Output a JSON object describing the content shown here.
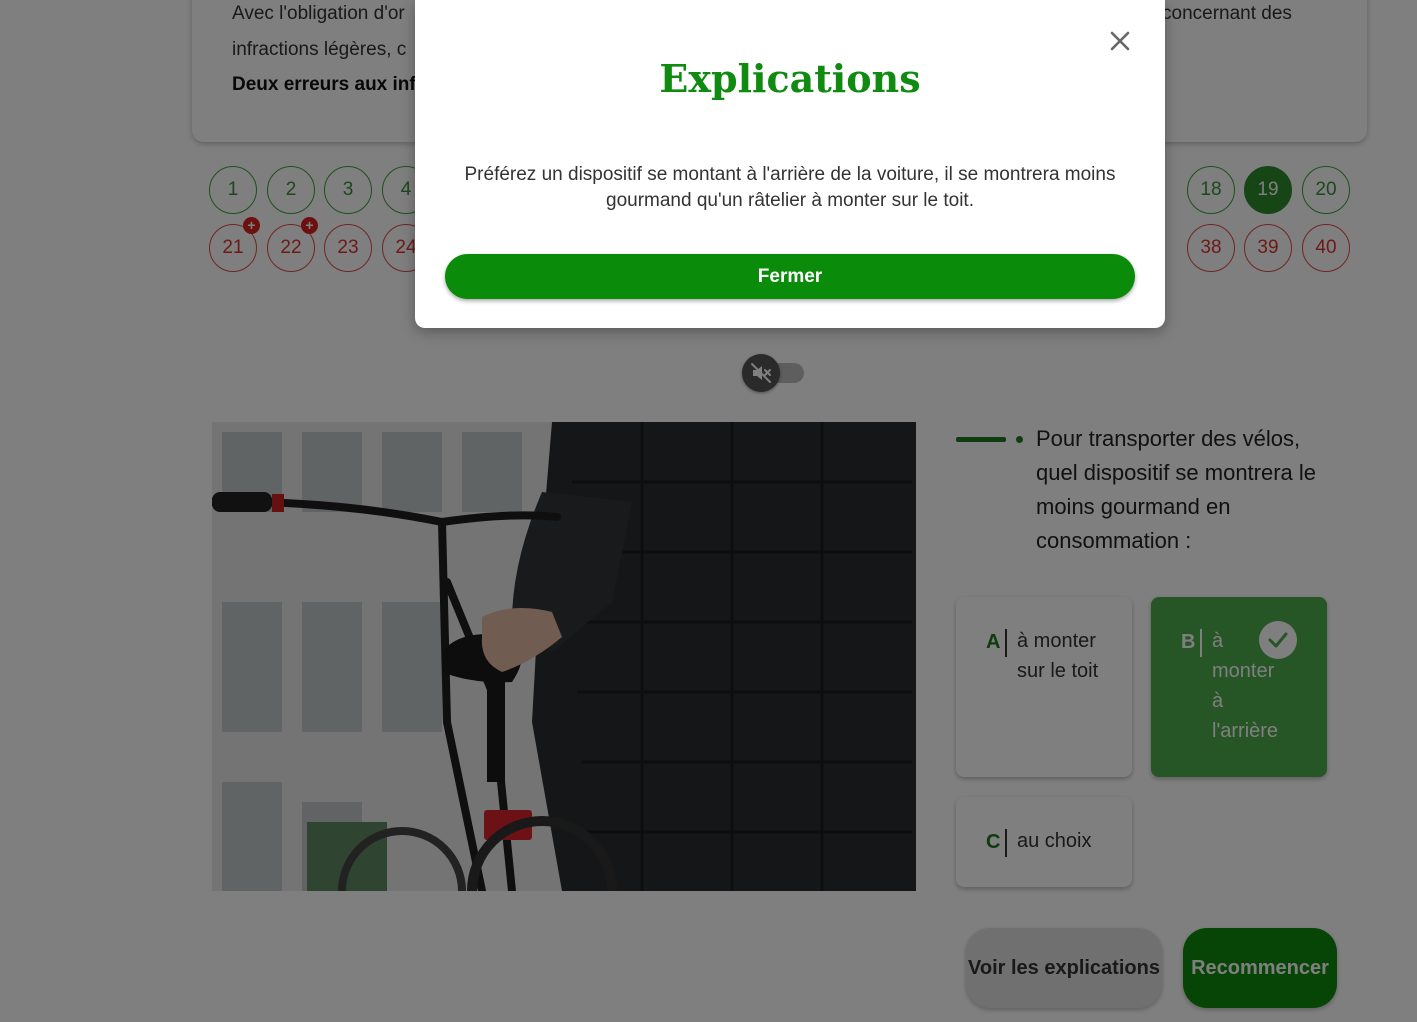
{
  "info": {
    "line1": "Avec l'obligation d'or",
    "line1_end": "concernant des",
    "line2": "infractions légères, c",
    "bold": "Deux erreurs aux inf"
  },
  "question_nav": {
    "row1": [
      {
        "n": "1",
        "state": "correct"
      },
      {
        "n": "2",
        "state": "correct"
      },
      {
        "n": "3",
        "state": "correct"
      },
      {
        "n": "4",
        "state": "correct"
      },
      {
        "n": "18",
        "state": "correct"
      },
      {
        "n": "19",
        "state": "current"
      },
      {
        "n": "20",
        "state": "correct"
      }
    ],
    "row2": [
      {
        "n": "21",
        "state": "wrong",
        "badge": "+"
      },
      {
        "n": "22",
        "state": "wrong",
        "badge": "+"
      },
      {
        "n": "23",
        "state": "wrong"
      },
      {
        "n": "24",
        "state": "wrong"
      },
      {
        "n": "38",
        "state": "wrong"
      },
      {
        "n": "39",
        "state": "wrong"
      },
      {
        "n": "40",
        "state": "wrong"
      }
    ]
  },
  "audio": {
    "icon": "speaker-muted-icon",
    "state": "off"
  },
  "question": {
    "text": "Pour transporter des vélos, quel dispositif se montrera le moins gourmand en consommation :"
  },
  "answers": [
    {
      "letter": "A",
      "text": "à monter sur le toit",
      "selected": false
    },
    {
      "letter": "B",
      "text": "à monter à l'arrière",
      "selected": true
    },
    {
      "letter": "C",
      "text": "au choix",
      "selected": false
    }
  ],
  "buttons": {
    "voir": "Voir les explications",
    "recommencer": "Recommencer"
  },
  "modal": {
    "title": "Explications",
    "body": "Préférez un dispositif se montant à l'arrière de la voiture, il se montrera moins gourmand qu'un râtelier à monter sur le toit.",
    "close_button": "Fermer",
    "close_icon": "close-icon"
  },
  "colors": {
    "brand_green": "#0a8c0a",
    "correct_green": "#3aa03a",
    "wrong_red": "#e04848"
  }
}
